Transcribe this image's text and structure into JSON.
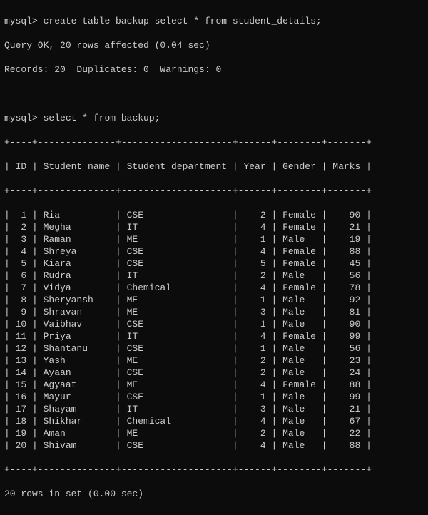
{
  "prompt": "mysql>",
  "commands": {
    "create": "create table backup select * from student_details;",
    "select": "select * from backup;"
  },
  "messages": {
    "query_ok": "Query OK, 20 rows affected (0.04 sec)",
    "records": "Records: 20  Duplicates: 0  Warnings: 0",
    "footer": "20 rows in set (0.00 sec)"
  },
  "border": "+----+--------------+--------------------+------+--------+-------+",
  "header": "| ID | Student_name | Student_department | Year | Gender | Marks |",
  "chart_data": {
    "type": "table",
    "columns": [
      "ID",
      "Student_name",
      "Student_department",
      "Year",
      "Gender",
      "Marks"
    ],
    "rows": [
      {
        "ID": 1,
        "Student_name": "Ria",
        "Student_department": "CSE",
        "Year": 2,
        "Gender": "Female",
        "Marks": 90
      },
      {
        "ID": 2,
        "Student_name": "Megha",
        "Student_department": "IT",
        "Year": 4,
        "Gender": "Female",
        "Marks": 21
      },
      {
        "ID": 3,
        "Student_name": "Raman",
        "Student_department": "ME",
        "Year": 1,
        "Gender": "Male",
        "Marks": 19
      },
      {
        "ID": 4,
        "Student_name": "Shreya",
        "Student_department": "CSE",
        "Year": 4,
        "Gender": "Female",
        "Marks": 88
      },
      {
        "ID": 5,
        "Student_name": "Kiara",
        "Student_department": "CSE",
        "Year": 5,
        "Gender": "Female",
        "Marks": 45
      },
      {
        "ID": 6,
        "Student_name": "Rudra",
        "Student_department": "IT",
        "Year": 2,
        "Gender": "Male",
        "Marks": 56
      },
      {
        "ID": 7,
        "Student_name": "Vidya",
        "Student_department": "Chemical",
        "Year": 4,
        "Gender": "Female",
        "Marks": 78
      },
      {
        "ID": 8,
        "Student_name": "Sheryansh",
        "Student_department": "ME",
        "Year": 1,
        "Gender": "Male",
        "Marks": 92
      },
      {
        "ID": 9,
        "Student_name": "Shravan",
        "Student_department": "ME",
        "Year": 3,
        "Gender": "Male",
        "Marks": 81
      },
      {
        "ID": 10,
        "Student_name": "Vaibhav",
        "Student_department": "CSE",
        "Year": 1,
        "Gender": "Male",
        "Marks": 90
      },
      {
        "ID": 11,
        "Student_name": "Priya",
        "Student_department": "IT",
        "Year": 4,
        "Gender": "Female",
        "Marks": 99
      },
      {
        "ID": 12,
        "Student_name": "Shantanu",
        "Student_department": "CSE",
        "Year": 1,
        "Gender": "Male",
        "Marks": 56
      },
      {
        "ID": 13,
        "Student_name": "Yash",
        "Student_department": "ME",
        "Year": 2,
        "Gender": "Male",
        "Marks": 23
      },
      {
        "ID": 14,
        "Student_name": "Ayaan",
        "Student_department": "CSE",
        "Year": 2,
        "Gender": "Male",
        "Marks": 24
      },
      {
        "ID": 15,
        "Student_name": "Agyaat",
        "Student_department": "ME",
        "Year": 4,
        "Gender": "Female",
        "Marks": 88
      },
      {
        "ID": 16,
        "Student_name": "Mayur",
        "Student_department": "CSE",
        "Year": 1,
        "Gender": "Male",
        "Marks": 99
      },
      {
        "ID": 17,
        "Student_name": "Shayam",
        "Student_department": "IT",
        "Year": 3,
        "Gender": "Male",
        "Marks": 21
      },
      {
        "ID": 18,
        "Student_name": "Shikhar",
        "Student_department": "Chemical",
        "Year": 4,
        "Gender": "Male",
        "Marks": 67
      },
      {
        "ID": 19,
        "Student_name": "Aman",
        "Student_department": "ME",
        "Year": 2,
        "Gender": "Male",
        "Marks": 22
      },
      {
        "ID": 20,
        "Student_name": "Shivam",
        "Student_department": "CSE",
        "Year": 4,
        "Gender": "Male",
        "Marks": 88
      }
    ]
  },
  "col_widths": {
    "ID": 2,
    "Student_name": 12,
    "Student_department": 18,
    "Year": 4,
    "Gender": 6,
    "Marks": 5
  }
}
